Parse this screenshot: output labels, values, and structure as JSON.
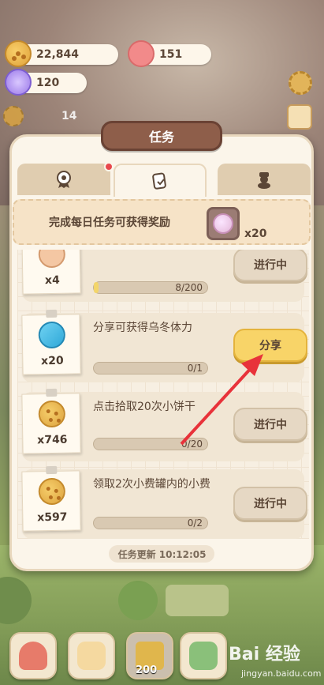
{
  "resources": {
    "cookies": "22,844",
    "pig": "151",
    "gems": "120",
    "left_count": "14"
  },
  "modal": {
    "title": "任务",
    "tabs": [
      {
        "icon": "badge-icon",
        "active": false,
        "has_dot": true
      },
      {
        "icon": "task-card-icon",
        "active": true,
        "has_dot": false
      },
      {
        "icon": "cat-icon",
        "active": false,
        "has_dot": false
      }
    ],
    "banner_text": "完成每日任务可获得奖励",
    "banner_reward_count": "x20",
    "tasks": [
      {
        "count": "x4",
        "desc": "",
        "progress": "8/200",
        "progress_fraction": 0.04,
        "button": "进行中",
        "icon": "ticket-icon"
      },
      {
        "count": "x20",
        "desc": "分享可获得乌冬体力",
        "progress": "0/1",
        "progress_fraction": 0,
        "button": "分享",
        "icon": "feather-icon"
      },
      {
        "count": "x746",
        "desc": "点击拾取20次小饼干",
        "progress": "0/20",
        "progress_fraction": 0,
        "button": "进行中",
        "icon": "cookie-icon"
      },
      {
        "count": "x597",
        "desc": "领取2次小费罐内的小费",
        "progress": "0/2",
        "progress_fraction": 0,
        "button": "进行中",
        "icon": "cookie-icon"
      }
    ],
    "footer": "任务更新 10:12:05"
  },
  "bottom": {
    "lock_count": "200",
    "watermark": "Bai 经验",
    "watermark_url": "jingyan.baidu.com"
  },
  "colors": {
    "accent": "#f8d468",
    "title_bg": "#8e5e4a",
    "arrow": "#e8323a"
  }
}
